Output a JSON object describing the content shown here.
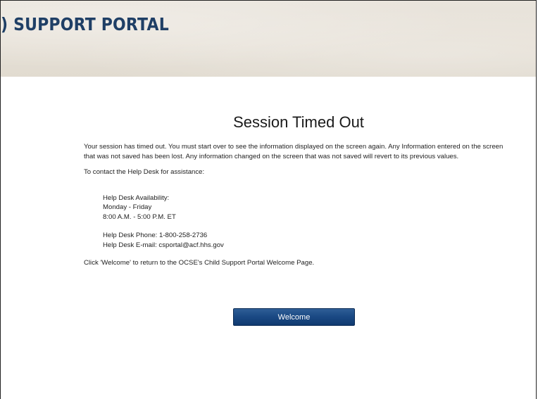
{
  "header": {
    "brand_text": ") SUPPORT PORTAL"
  },
  "main": {
    "title": "Session Timed Out",
    "message": "Your session has timed out. You must start over to see the information displayed on the screen again. Any Information entered on the screen that was not saved has been lost. Any information changed on the screen that was not saved will revert to its previous values.",
    "contact_intro": "To contact the Help Desk for assistance:",
    "availability_label": "Help Desk Availability:",
    "availability_days": "Monday - Friday",
    "availability_hours": "8:00 A.M. - 5:00 P.M. ET",
    "phone_line": "Help Desk Phone: 1-800-258-2736",
    "email_line": "Help Desk E-mail: csportal@acf.hhs.gov",
    "return_instruction": "Click 'Welcome' to return to the OCSE's Child Support Portal Welcome Page.",
    "welcome_button_label": "Welcome"
  },
  "colors": {
    "brand": "#1f3f66",
    "button": "#1b4a85",
    "banner": "#e6e0d6"
  }
}
